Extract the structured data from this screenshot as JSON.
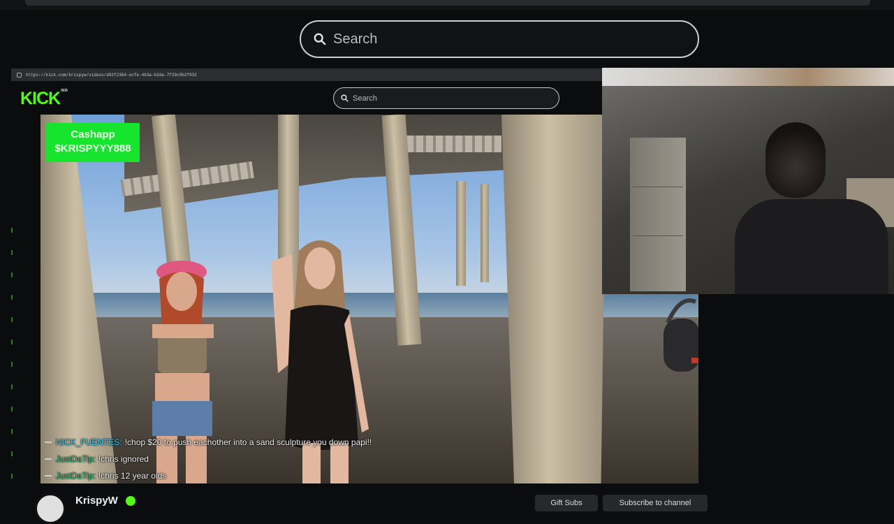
{
  "browser": {
    "search_placeholder": "Search",
    "url": "https://kick.com/krispyw/videos/d92f2364-ecfe-4b3a-b2da-7f29c9b2f932"
  },
  "kick": {
    "logo": "KICK",
    "logo_badge": "BETA",
    "search_placeholder": "Search",
    "brand_color": "#53fc18"
  },
  "overlay": {
    "cashapp_line1": "Cashapp",
    "cashapp_line2": "$KRISPYYY888"
  },
  "chat": [
    {
      "user": "NICK_FUENTES:",
      "user_color": "#3fd6ff",
      "message": "!chop $20 to push eachother into a sand sculpture you down papi!!"
    },
    {
      "user": "JustDaTip:",
      "user_color": "#2ec27e",
      "message": "!chris ignored"
    },
    {
      "user": "JustDaTip:",
      "user_color": "#2ec27e",
      "message": "!chris 12 year olds"
    }
  ],
  "channel": {
    "name": "KrispyW",
    "gift_label": "Gift Subs",
    "subscribe_label": "Subscribe to channel"
  }
}
